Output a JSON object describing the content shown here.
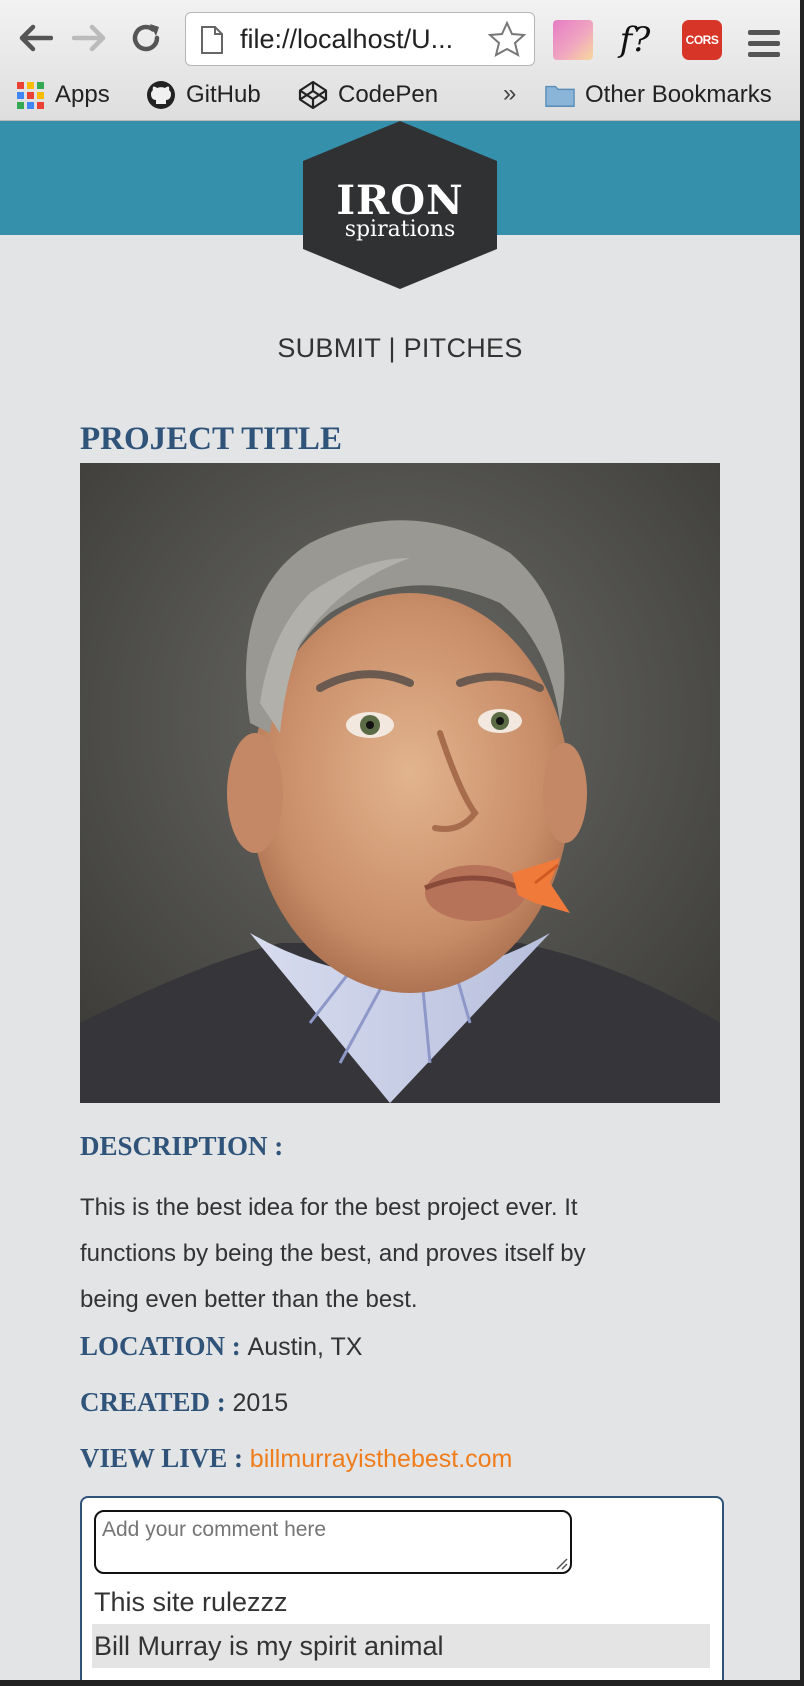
{
  "browser": {
    "url": "file://localhost/U...",
    "extensions": {
      "f_label": "f?",
      "cors_label": "CORS"
    },
    "bookmarks": {
      "apps": "Apps",
      "github": "GitHub",
      "codepen": "CodePen",
      "overflow": "»",
      "other": "Other Bookmarks"
    }
  },
  "site": {
    "logo_top": "IRON",
    "logo_bottom": "spirations",
    "colors": {
      "banner": "#3590ac",
      "heading": "#2f5379",
      "link": "#f07d1c"
    }
  },
  "nav": {
    "submit": "SUBMIT",
    "separator": " | ",
    "pitches": "PITCHES"
  },
  "project": {
    "title": "PROJECT TITLE",
    "description_label": "DESCRIPTION :",
    "description": "This is the best idea for the best project ever. It functions by being the best, and proves itself by being even better than the best.",
    "location_label": "LOCATION :",
    "location": "Austin, TX",
    "created_label": "CREATED :",
    "created": "2015",
    "view_live_label": "VIEW LIVE :",
    "view_live_url": "billmurrayisthebest.com"
  },
  "comments": {
    "placeholder": "Add your comment here",
    "items": [
      "This site rulezzz",
      "Bill Murray is my spirit animal"
    ]
  }
}
